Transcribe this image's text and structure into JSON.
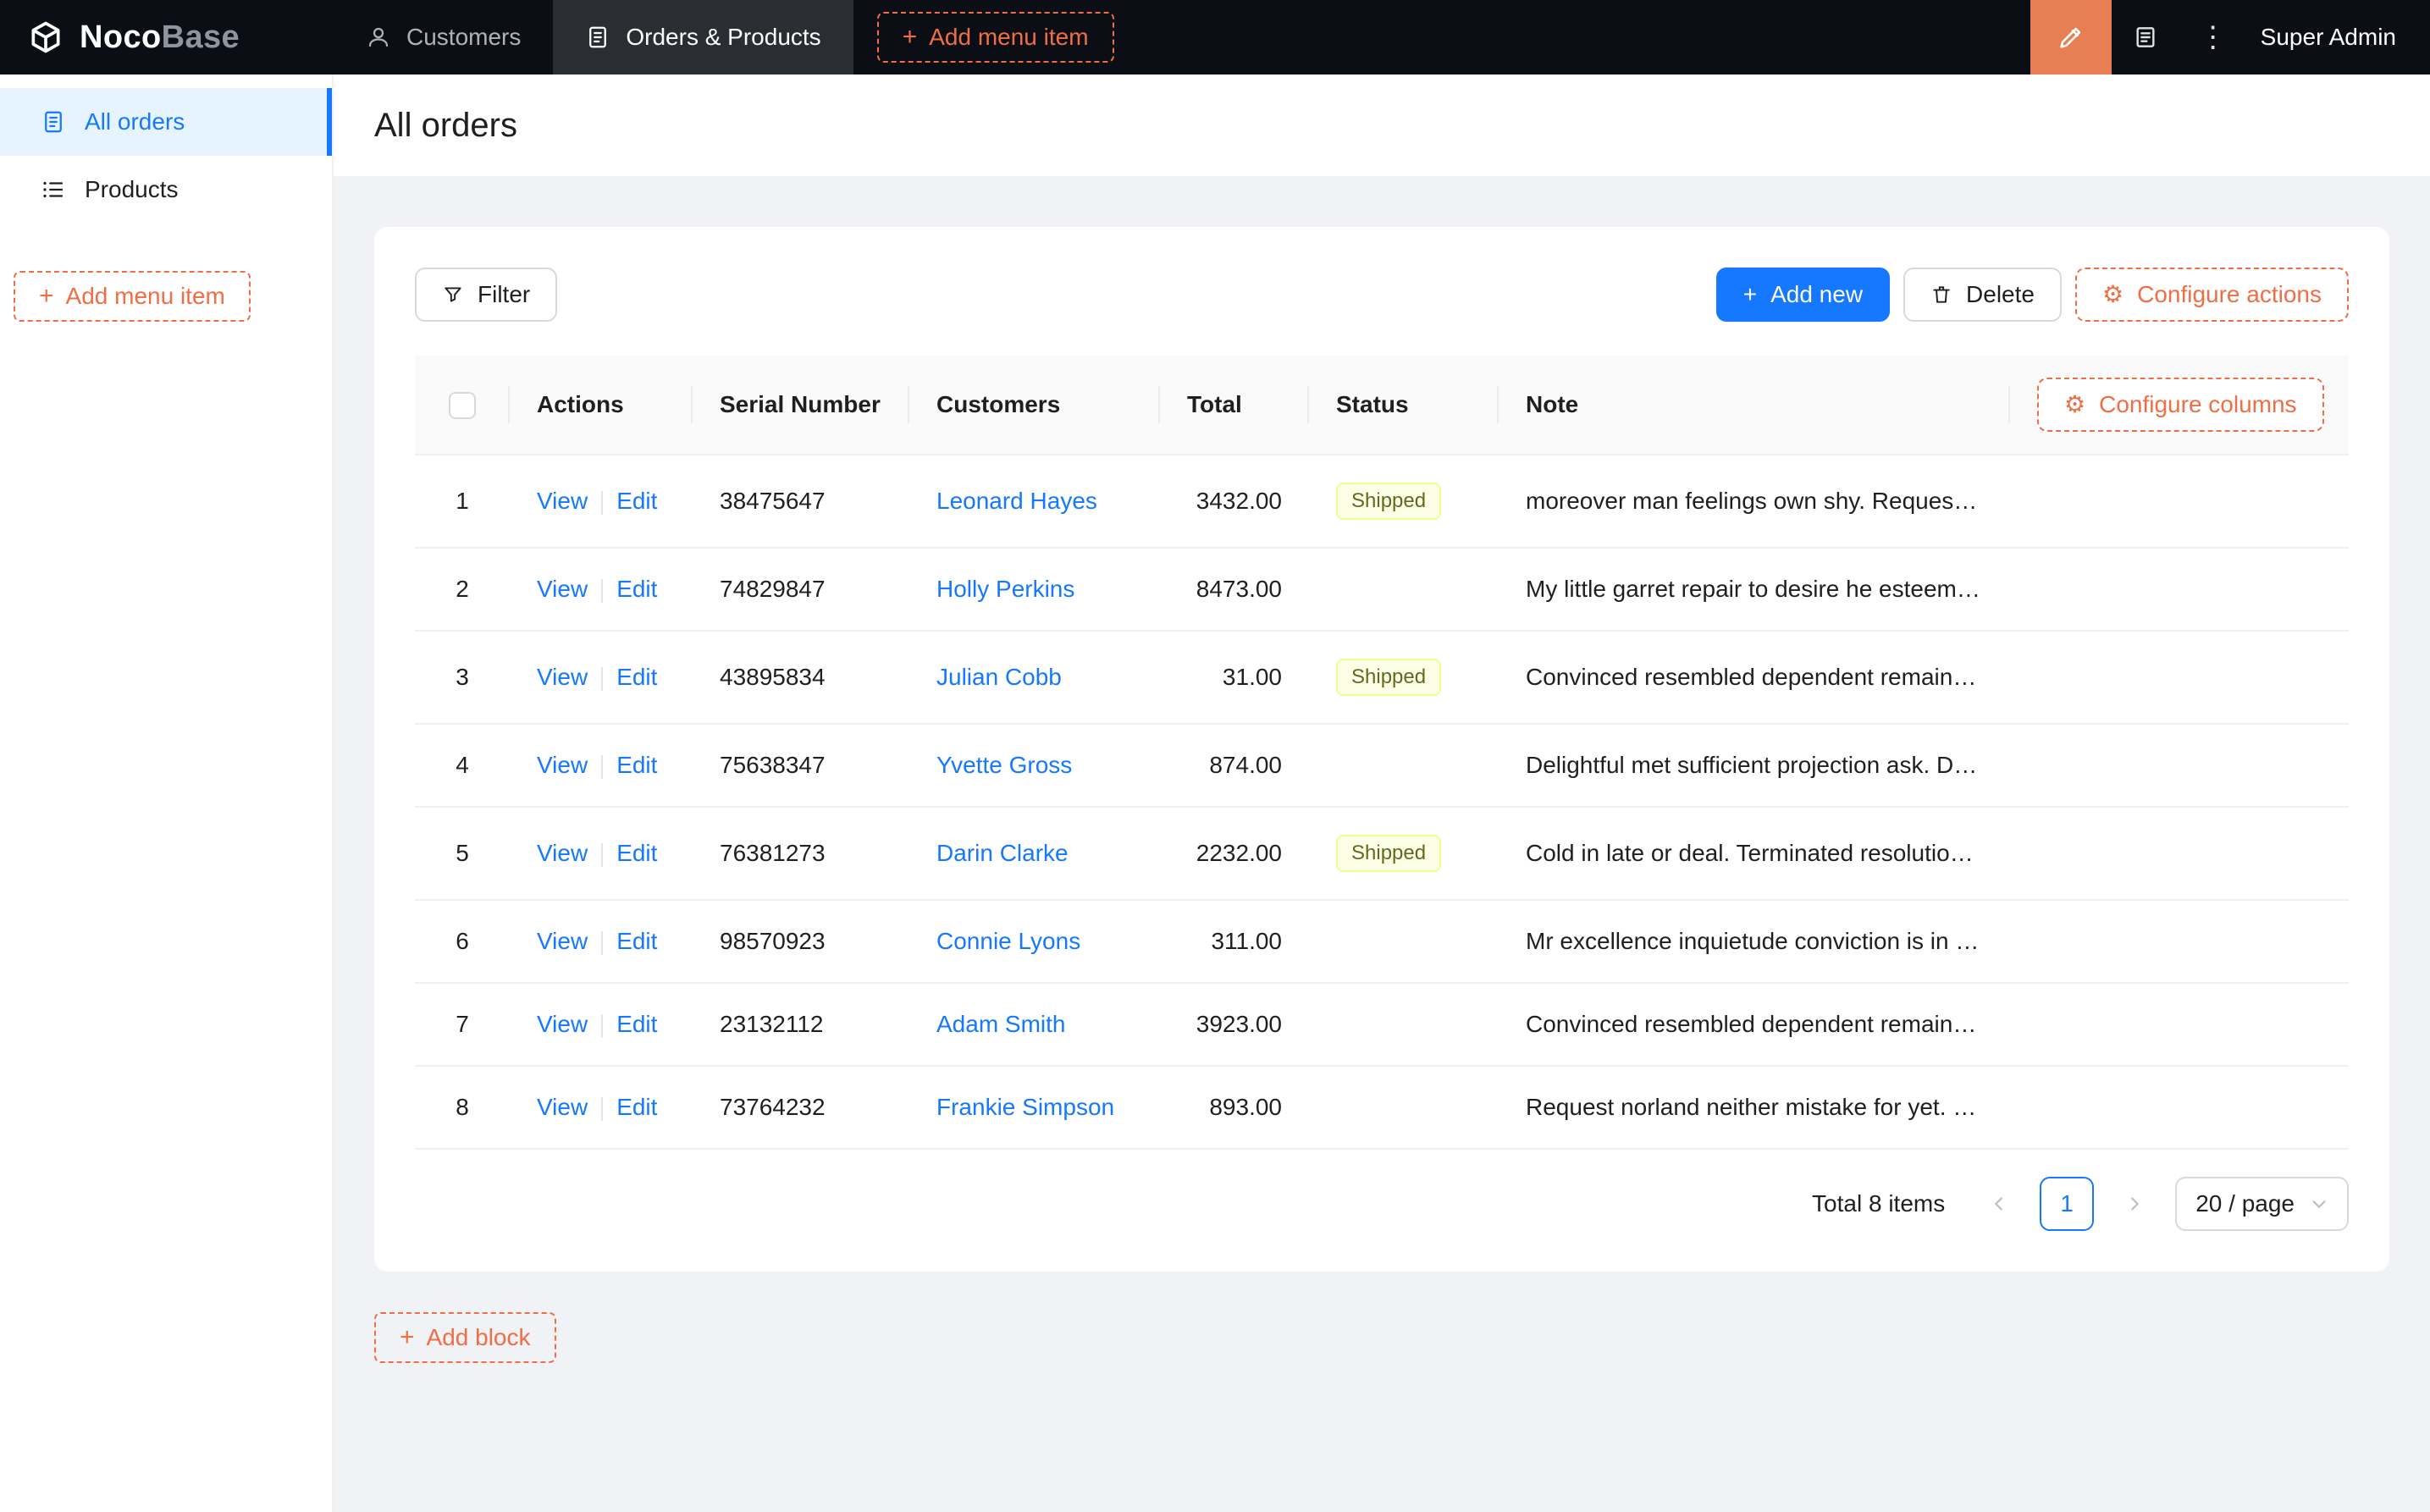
{
  "navbar": {
    "logo_primary": "Noco",
    "logo_secondary": "Base",
    "items": [
      {
        "label": "Customers"
      },
      {
        "label": "Orders & Products"
      }
    ],
    "add_menu_item": "Add menu item",
    "more_icon": "⋮",
    "user": "Super Admin"
  },
  "sidebar": {
    "items": [
      {
        "label": "All orders"
      },
      {
        "label": "Products"
      }
    ],
    "add_menu_item": "Add menu item"
  },
  "page": {
    "title": "All orders"
  },
  "toolbar": {
    "filter": "Filter",
    "add_new": "Add new",
    "delete": "Delete",
    "configure_actions": "Configure actions",
    "plus": "+",
    "gear": "⚙"
  },
  "table": {
    "configure_columns": "Configure columns",
    "columns": {
      "actions": "Actions",
      "serial": "Serial Number",
      "customers": "Customers",
      "total": "Total",
      "status": "Status",
      "note": "Note"
    },
    "actions": {
      "view": "View",
      "edit": "Edit"
    },
    "rows": [
      {
        "index": "1",
        "serial": "38475647",
        "customer": "Leonard Hayes",
        "total": "3432.00",
        "status": "Shipped",
        "note": "moreover man feelings own shy. Request n..."
      },
      {
        "index": "2",
        "serial": "74829847",
        "customer": "Holly Perkins",
        "total": "8473.00",
        "status": "",
        "note": "My little garret repair to desire he esteem. ..."
      },
      {
        "index": "3",
        "serial": "43895834",
        "customer": "Julian Cobb",
        "total": "31.00",
        "status": "Shipped",
        "note": "Convinced resembled dependent remainde..."
      },
      {
        "index": "4",
        "serial": "75638347",
        "customer": "Yvette Gross",
        "total": "874.00",
        "status": "",
        "note": "Delightful met sufficient projection ask. De..."
      },
      {
        "index": "5",
        "serial": "76381273",
        "customer": "Darin Clarke",
        "total": "2232.00",
        "status": "Shipped",
        "note": "Cold in late or deal. Terminated resolution ..."
      },
      {
        "index": "6",
        "serial": "98570923",
        "customer": "Connie Lyons",
        "total": "311.00",
        "status": "",
        "note": "Mr excellence inquietude conviction is in u..."
      },
      {
        "index": "7",
        "serial": "23132112",
        "customer": "Adam Smith",
        "total": "3923.00",
        "status": "",
        "note": "Convinced resembled dependent remainde..."
      },
      {
        "index": "8",
        "serial": "73764232",
        "customer": "Frankie Simpson",
        "total": "893.00",
        "status": "",
        "note": "Request norland neither mistake for yet. Be..."
      }
    ]
  },
  "pagination": {
    "total_text": "Total 8 items",
    "current_page": "1",
    "page_size": "20 / page"
  },
  "add_block": "Add block",
  "icons": {
    "logo-icon": "cube",
    "customers-icon": "user",
    "orders-products-icon": "form",
    "add-icon": "plus",
    "ui-editor-icon": "highlighter",
    "plugins-icon": "book",
    "more-icon": "vertical-ellipsis",
    "all-orders-icon": "form",
    "products-icon": "list",
    "filter-icon": "funnel",
    "delete-icon": "trash",
    "configure-icon": "gear",
    "prev-icon": "chevron-left",
    "next-icon": "chevron-right",
    "page-size-icon": "chevron-down",
    "select-all-checkbox": "empty-checkbox"
  },
  "colors": {
    "navbar_bg": "#0B0E14",
    "accent_orange": "#F06E45",
    "designer_button_bg": "#E87E54",
    "primary_blue": "#1677FF",
    "selected_item_bg": "#E6F4FF",
    "tag_bg": "#FCFFE6",
    "tag_border": "#EAFF8F",
    "tag_text": "#5E6B1F",
    "page_bg": "#F0F2F5",
    "table_header_bg": "#FAFAFA"
  }
}
